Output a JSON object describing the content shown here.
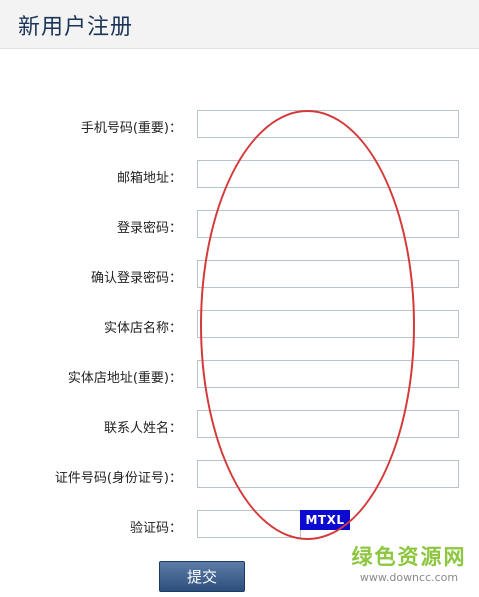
{
  "header": {
    "title": "新用户注册"
  },
  "form": {
    "fields": [
      {
        "label": "手机号码(重要)：",
        "value": ""
      },
      {
        "label": "邮箱地址：",
        "value": ""
      },
      {
        "label": "登录密码：",
        "value": ""
      },
      {
        "label": "确认登录密码：",
        "value": ""
      },
      {
        "label": "实体店名称：",
        "value": ""
      },
      {
        "label": "实体店地址(重要)：",
        "value": ""
      },
      {
        "label": "联系人姓名：",
        "value": ""
      },
      {
        "label": "证件号码(身份证号)：",
        "value": ""
      }
    ],
    "captcha": {
      "label": "验证码：",
      "value": "",
      "code": "MTXL"
    },
    "submit_label": "提交"
  },
  "watermark": {
    "title": "绿色资源网",
    "url": "www.downcc.com"
  },
  "colors": {
    "header_title": "#1b3558",
    "annotation": "#d43a3a",
    "captcha_bg": "#0a0ad0",
    "button": "#3a5a88",
    "watermark": "#8dc63f"
  }
}
